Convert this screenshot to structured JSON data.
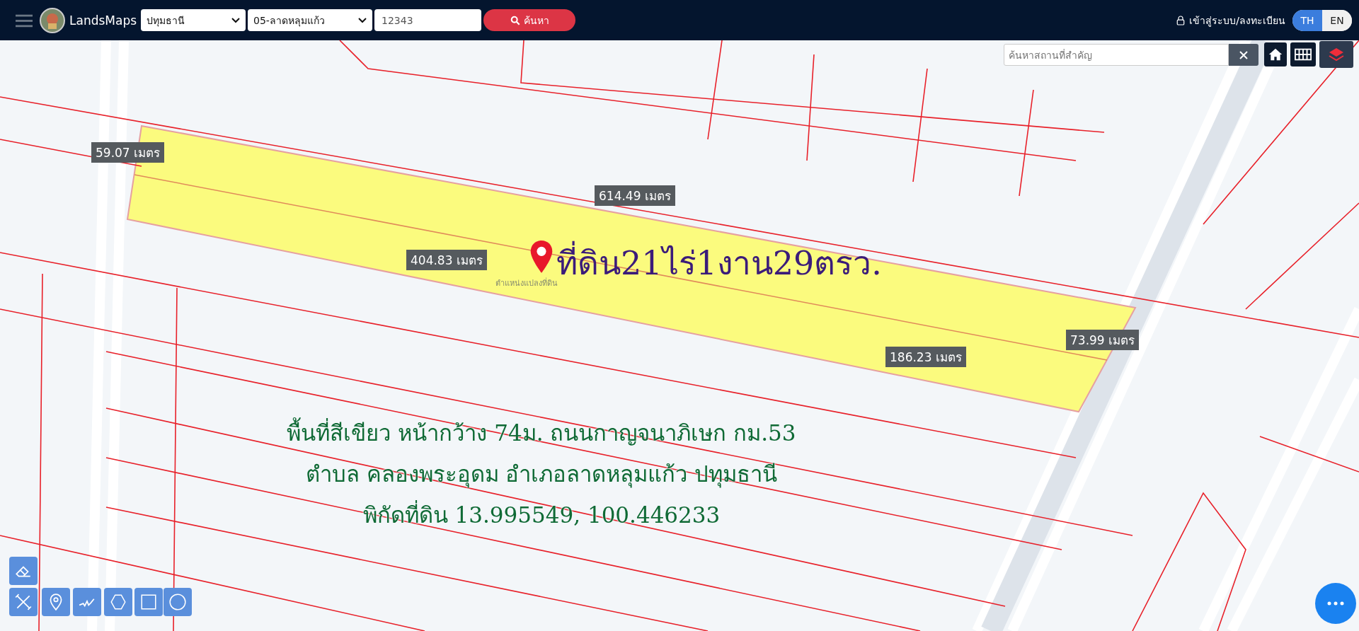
{
  "header": {
    "brand": "LandsMaps",
    "province": "ปทุมธานี",
    "district": "05-ลาดหลุมแก้ว",
    "parcel_number": "12343",
    "search_button": "ค้นหา",
    "login": "เข้าสู่ระบบ/ลงทะเบียน",
    "languages": [
      {
        "label": "TH",
        "selected": true
      },
      {
        "label": "EN",
        "selected": false
      }
    ]
  },
  "place_search": {
    "placeholder": "ค้นหาสถานที่สำคัญ"
  },
  "measurements": [
    "59.07 เมตร",
    "614.49 เมตร",
    "404.83 เมตร",
    "73.99 เมตร",
    "186.23 เมตร"
  ],
  "marker_label": "ตำแหน่งแปลงที่ดิน",
  "parcel_title": "ที่ดิน21ไร่1งาน29ตรว.",
  "description_lines": [
    "พื้นที่สีเขียว หน้ากว้าง 74ม. ถนนกาญจนาภิเษก กม.53",
    "ตำบล คลองพระอุดม อำเภอลาดหลุมแก้ว ปทุมธานี",
    "พิกัดที่ดิน 13.995549, 100.446233"
  ]
}
